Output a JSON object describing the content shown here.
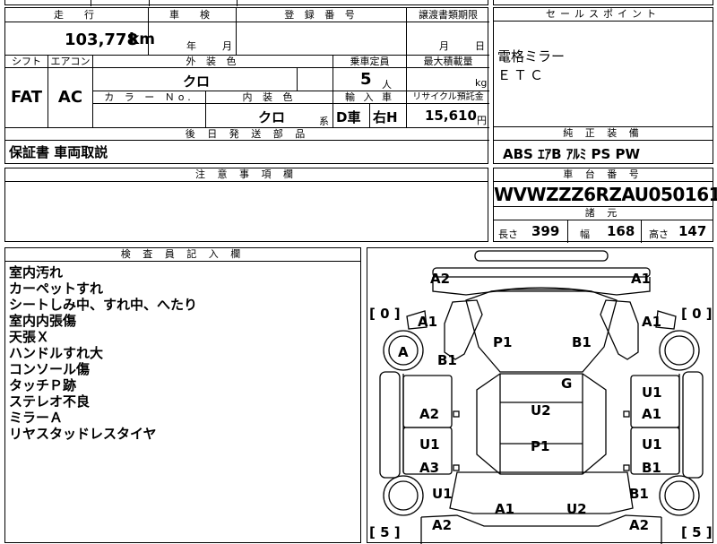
{
  "top_left": {
    "mileage_label": "走　行",
    "mileage_value": "103,778",
    "mileage_unit": "km",
    "inspection_label": "車　検",
    "inspection_year": "年",
    "inspection_month": "月",
    "registration_label": "登 録 番 号",
    "registration_value": "",
    "transfer_label": "譲渡書類期限",
    "transfer_month": "月",
    "transfer_day": "日",
    "shift_label": "シフト",
    "shift_value": "FAT",
    "aircon_label": "エアコン",
    "aircon_value": "AC",
    "ext_color_label": "外 装 色",
    "ext_color_value": "クロ",
    "seats_label": "乗車定員",
    "seats_value": "5",
    "seats_unit": "人",
    "load_label": "最大積載量",
    "load_unit": "kg",
    "color_no_label": "カ ラ ー Ｎo.",
    "int_color_label": "内 装 色",
    "int_color_value": "クロ",
    "int_color_unit": "系",
    "import_label": "輸 入 車",
    "import_value1": "D車",
    "import_value2": "右H",
    "recycle_label": "リサイクル預託金",
    "recycle_value": "15,610",
    "recycle_unit": "円",
    "later_parts_label": "後 日 発 送 部 品",
    "later_parts_value": "保証書 車両取説",
    "caution_label": "注 意 事 項 欄"
  },
  "sales_points": {
    "label": "セールスポイント",
    "items": [
      "電格ミラー",
      "ＥＴＣ"
    ]
  },
  "equipment": {
    "label": "純 正 装 備",
    "value": "ABS ｴｱB ｱﾙﾐ PS PW"
  },
  "chassis": {
    "label": "車 台 番 号",
    "value": "WVWZZZ6RZAU050161"
  },
  "dimensions": {
    "label": "諸 元",
    "length_label": "長さ",
    "length_value": "399",
    "width_label": "幅",
    "width_value": "168",
    "height_label": "高さ",
    "height_value": "147"
  },
  "inspector_notes": {
    "label": "検 査 員 記 入 欄",
    "lines": [
      "室内汚れ",
      "カーペットすれ",
      "シートしみ中、すれ中、へたり",
      "室内内張傷",
      "天張Ｘ",
      "ハンドルすれ大",
      "コンソール傷",
      "タッチＰ跡",
      "ステレオ不良",
      "ミラーＡ",
      "リヤスタッドレスタイヤ"
    ]
  },
  "diagram_marks": {
    "tl": "A2",
    "tr": "A1",
    "tire_fl": "[ 0 ]",
    "tire_fr": "[ 0 ]",
    "tire_rl": "[ 5 ]",
    "tire_rr": "[ 5 ]",
    "l_a1": "A1",
    "r_a1": "A1",
    "wheel_a": "A",
    "b1_left": "B1",
    "p1_top": "P1",
    "b1_top": "B1",
    "g": "G",
    "u2_mid": "U2",
    "p1_mid": "P1",
    "l_a2": "A2",
    "l_u1": "U1",
    "l_a3": "A3",
    "r_u1a": "U1",
    "r_a1b": "A1",
    "r_u1b": "U1",
    "r_b1b": "B1",
    "l_u1_low": "U1",
    "r_b1_low": "B1",
    "bot_a1": "A1",
    "bot_u2": "U2",
    "bl": "A2",
    "br": "A2"
  }
}
